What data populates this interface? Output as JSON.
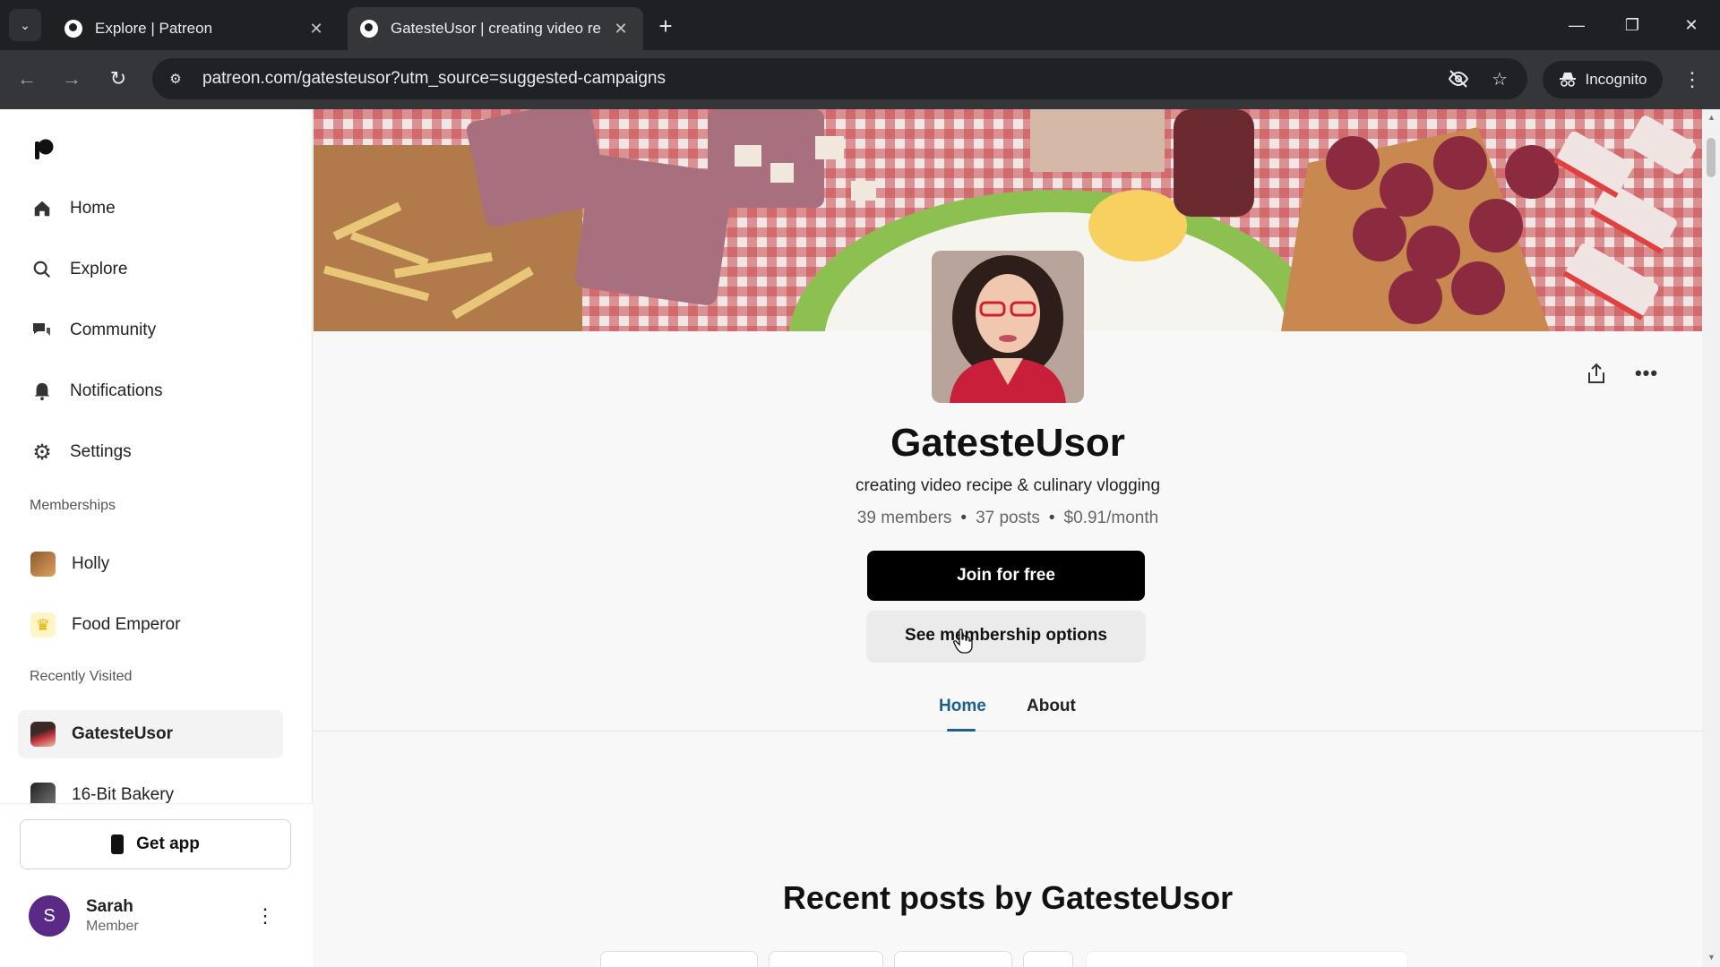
{
  "browser": {
    "tabs": [
      {
        "title": "Explore | Patreon",
        "active": false
      },
      {
        "title": "GatesteUsor | creating video re",
        "active": true
      }
    ],
    "url": "patreon.com/gatesteusor?utm_source=suggested-campaigns",
    "incognito_label": "Incognito"
  },
  "sidebar": {
    "nav": [
      {
        "label": "Home",
        "icon": "home-icon"
      },
      {
        "label": "Explore",
        "icon": "search-icon"
      },
      {
        "label": "Community",
        "icon": "chat-icon"
      },
      {
        "label": "Notifications",
        "icon": "bell-icon"
      },
      {
        "label": "Settings",
        "icon": "gear-icon"
      }
    ],
    "memberships_label": "Memberships",
    "memberships": [
      {
        "label": "Holly"
      },
      {
        "label": "Food Emperor"
      }
    ],
    "recent_label": "Recently Visited",
    "recent": [
      {
        "label": "GatesteUsor"
      },
      {
        "label": "16-Bit Bakery"
      }
    ],
    "get_app": "Get app",
    "user": {
      "initial": "S",
      "name": "Sarah",
      "role": "Member"
    }
  },
  "creator": {
    "name": "GatesteUsor",
    "tagline": "creating video recipe & culinary vlogging",
    "members": "39 members",
    "posts": "37 posts",
    "price": "$0.91/month",
    "join_label": "Join for free",
    "options_label": "See membership options"
  },
  "page_tabs": [
    {
      "label": "Home",
      "active": true
    },
    {
      "label": "About",
      "active": false
    }
  ],
  "recent_posts_title": "Recent posts by GatesteUsor",
  "colors": {
    "active_tab": "#1f5f8b",
    "join_button": "#000000",
    "avatar_bg": "#5b2a86"
  }
}
